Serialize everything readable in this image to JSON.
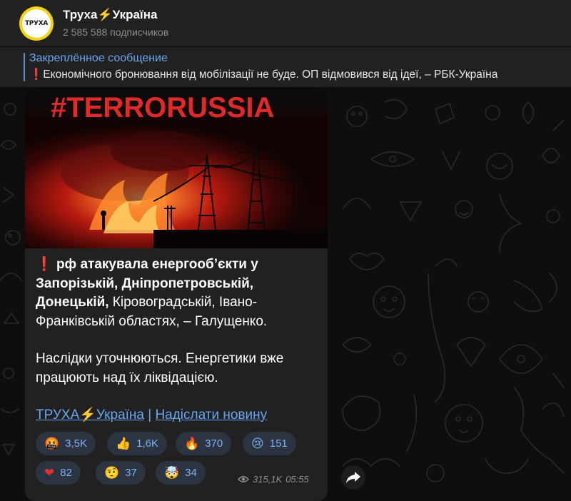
{
  "channel": {
    "title": "Труха⚡️Україна",
    "avatar_text": "ТРУХА",
    "subscribers": "2 585 588 подписчиков"
  },
  "pinned": {
    "title": "Закреплённое сообщение",
    "text": "❗Економічного бронювання від мобілізації не буде. ОП відмовився від ідеї, – РБК-Україна"
  },
  "post": {
    "image_caption": "#TERRORUSSIA",
    "line1_icon": "❗",
    "line1_bold": "рф атакувала енергооб’єкти у Запорізькій, Дніпропетровській, Донецькій,",
    "line1_rest": " Кіровоградській, Івано-Франківській областях, – Галущенко.",
    "line2": "Наслідки уточнюються. Енергетики вже працюють над їх ліквідацією.",
    "link_channel": "ТРУХА⚡️Україна",
    "link_separator": " | ",
    "link_send": "Надіслати новину",
    "views": "315,1K",
    "time": "05:55"
  },
  "reactions": [
    {
      "emoji": "🤬",
      "icon": "cursing-face-icon",
      "count": "3,5K"
    },
    {
      "emoji": "👍",
      "icon": "thumbs-up-icon",
      "count": "1,6K"
    },
    {
      "emoji": "🔥",
      "icon": "fire-icon",
      "count": "370"
    },
    {
      "emoji": "😢",
      "icon": "crying-face-icon",
      "count": "151"
    },
    {
      "emoji": "❤",
      "icon": "heart-icon",
      "count": "82"
    },
    {
      "emoji": "🤨",
      "icon": "raised-eyebrow-face-icon",
      "count": "37"
    },
    {
      "emoji": "🤯",
      "icon": "exploding-head-icon",
      "count": "34"
    }
  ],
  "colors": {
    "header_bg": "#212121",
    "bubble_bg": "#212121",
    "accent_link": "#6aa6f0",
    "avatar_ring": "#f6d20a",
    "reaction_bg": "#2c3442",
    "image_text_red": "#e02a2a"
  }
}
